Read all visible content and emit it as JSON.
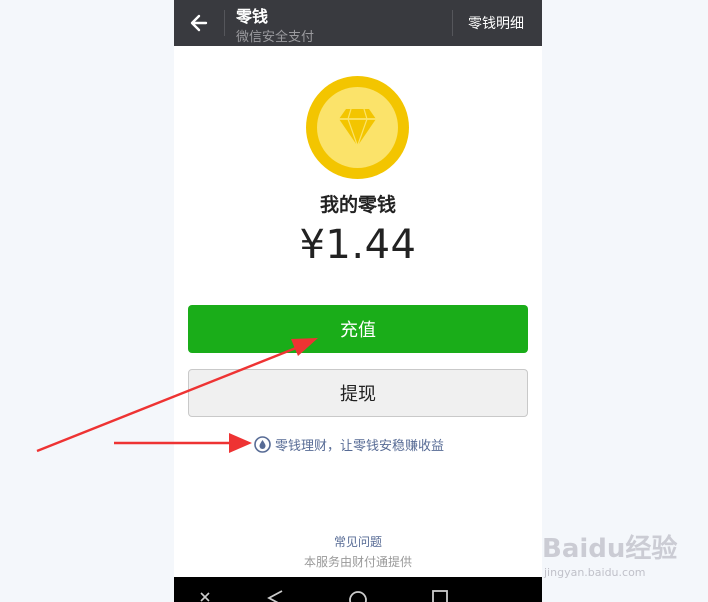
{
  "header": {
    "title": "零钱",
    "subtitle": "微信安全支付",
    "detail_label": "零钱明细"
  },
  "wallet": {
    "label": "我的零钱",
    "amount": "¥1.44"
  },
  "actions": {
    "topup_label": "充值",
    "withdraw_label": "提现"
  },
  "promo": {
    "text": "零钱理财，让零钱安稳赚收益",
    "icon": "water-drop-icon"
  },
  "footer": {
    "faq_label": "常见问题",
    "provider_text": "本服务由财付通提供"
  },
  "watermark": {
    "logo": "Baidu经验",
    "url": "jingyan.baidu.com"
  },
  "colors": {
    "topbar": "#393a3f",
    "primary_green": "#1aad19",
    "link_blue": "#576b95",
    "coin_gold": "#f3c500",
    "annotation_red": "#ee3333"
  },
  "icons": {
    "back": "back-arrow-icon",
    "coin": "diamond-coin-icon",
    "nav": [
      "close-icon",
      "back-triangle-icon",
      "home-circle-icon",
      "recent-square-icon"
    ]
  }
}
